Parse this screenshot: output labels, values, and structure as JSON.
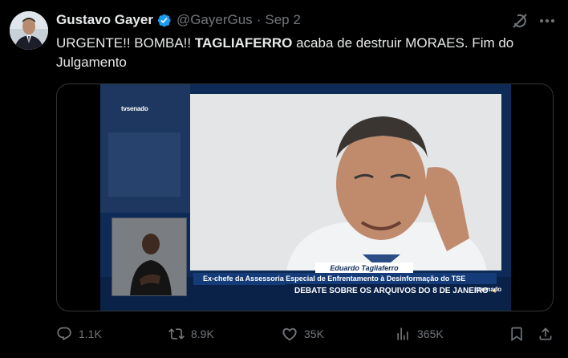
{
  "author": {
    "name": "Gustavo Gayer",
    "handle": "@GayerGus",
    "separator": "·",
    "date": "Sep 2",
    "verified": true,
    "verified_color": "#1d9bf0"
  },
  "tweet": {
    "text_part1": "URGENTE!! BOMBA!! ",
    "text_bold": "TAGLIAFERRO",
    "text_part2": " acaba de destruir MORAES. Fim do Julgamento"
  },
  "media": {
    "channel_logo": "tvsenado",
    "speaker_name": "Eduardo Tagliaferro",
    "speaker_role": "Ex-chefe da Assessoria Especial de Enfrentamento à Desinformação do TSE",
    "segment_title": "DEBATE SOBRE OS ARQUIVOS DO 8 DE JANEIRO",
    "segment_arrow": "◂"
  },
  "actions": {
    "replies": "1.1K",
    "reposts": "8.9K",
    "likes": "35K",
    "views": "365K"
  },
  "icons": {
    "header": [
      "verified-badge-icon",
      "grok-icon",
      "more-icon"
    ],
    "actions": [
      "reply-icon",
      "repost-icon",
      "like-icon",
      "views-icon",
      "bookmark-icon",
      "share-icon"
    ]
  },
  "colors": {
    "background": "#000000",
    "text": "#e7e9ea",
    "muted": "#71767b",
    "broadcast_blue": "#0e2a56"
  }
}
